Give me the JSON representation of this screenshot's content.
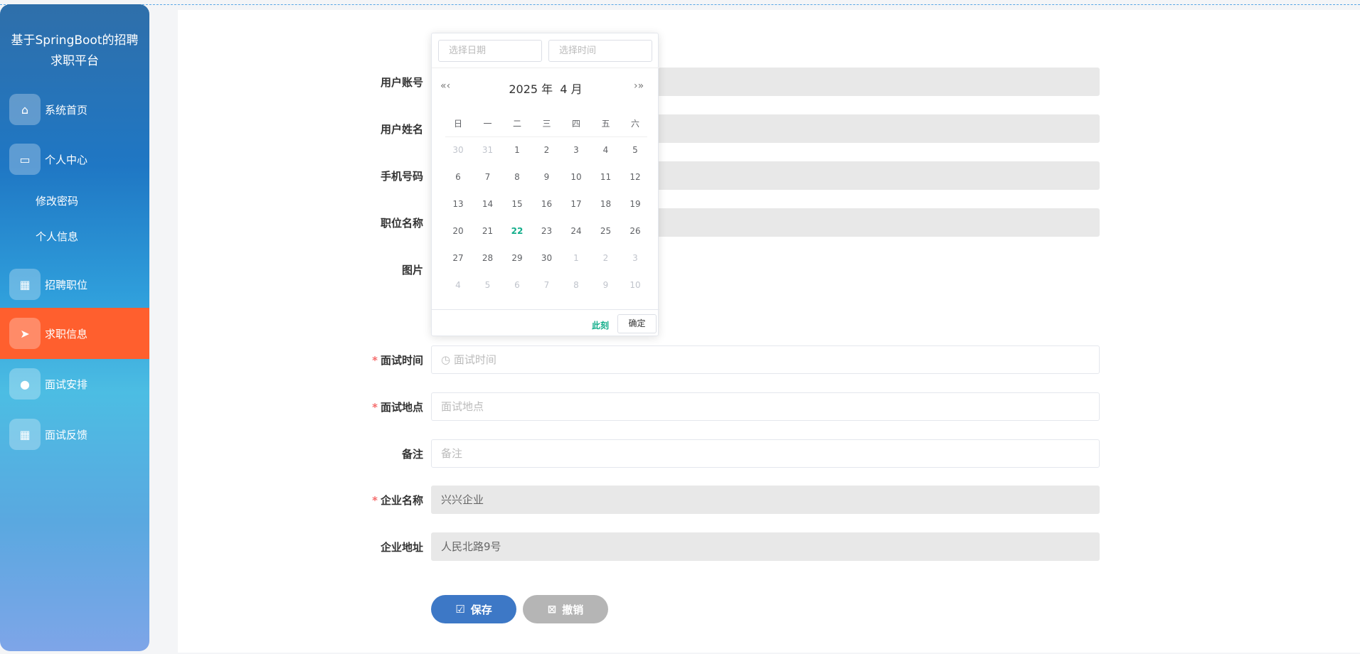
{
  "sidebar": {
    "title_line1": "基于SpringBoot的招聘",
    "title_line2": "求职平台",
    "items": [
      {
        "label": "系统首页"
      },
      {
        "label": "个人中心"
      },
      {
        "label": "招聘职位"
      },
      {
        "label": "求职信息"
      },
      {
        "label": "面试安排"
      },
      {
        "label": "面试反馈"
      }
    ],
    "subitems": [
      {
        "label": "修改密码"
      },
      {
        "label": "个人信息"
      }
    ]
  },
  "form": {
    "fields": [
      {
        "label": "用户账号",
        "value": ""
      },
      {
        "label": "用户姓名",
        "value": ""
      },
      {
        "label": "手机号码",
        "value": ""
      },
      {
        "label": "职位名称",
        "value": ""
      },
      {
        "label": "图片"
      },
      {
        "label": "面试时间",
        "placeholder": "面试时间",
        "required": true
      },
      {
        "label": "面试地点",
        "placeholder": "面试地点",
        "required": true
      },
      {
        "label": "备注",
        "placeholder": "备注"
      },
      {
        "label": "企业名称",
        "value": "兴兴企业",
        "required": true
      },
      {
        "label": "企业地址",
        "value": "人民北路9号"
      }
    ],
    "save": "保存",
    "cancel": "撤销",
    "required_mark": "*"
  },
  "picker": {
    "date_placeholder": "选择日期",
    "time_placeholder": "选择时间",
    "year_month": "2025 年  4 月",
    "prev": "«‹",
    "next": "›»",
    "weekdays": [
      "日",
      "一",
      "二",
      "三",
      "四",
      "五",
      "六"
    ],
    "weeks": [
      [
        "30",
        "31",
        "1",
        "2",
        "3",
        "4",
        "5"
      ],
      [
        "6",
        "7",
        "8",
        "9",
        "10",
        "11",
        "12"
      ],
      [
        "13",
        "14",
        "15",
        "16",
        "17",
        "18",
        "19"
      ],
      [
        "20",
        "21",
        "22",
        "23",
        "24",
        "25",
        "26"
      ],
      [
        "27",
        "28",
        "29",
        "30",
        "1",
        "2",
        "3"
      ],
      [
        "4",
        "5",
        "6",
        "7",
        "8",
        "9",
        "10"
      ]
    ],
    "today": "22",
    "now": "此刻",
    "confirm": "确定"
  }
}
